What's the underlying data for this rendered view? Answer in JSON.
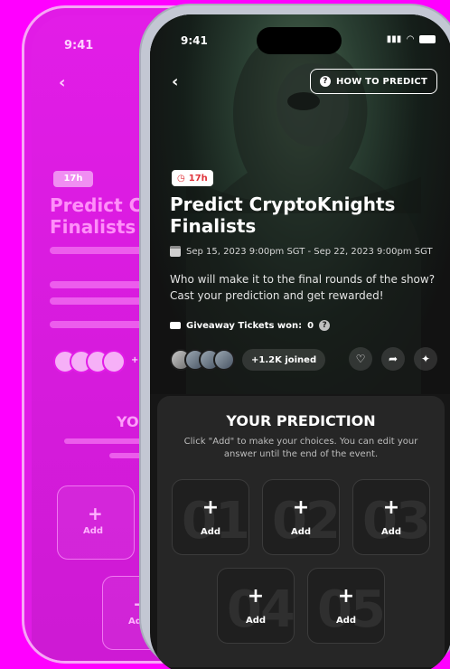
{
  "status": {
    "time": "9:41"
  },
  "header": {
    "how_to_predict": "HOW TO PREDICT"
  },
  "event": {
    "timer": "17h",
    "title": "Predict CryptoKnights Finalists",
    "date_range": "Sep 15, 2023 9:00pm SGT - Sep 22, 2023 9:00pm SGT",
    "description": "Who will make it to the final rounds of the show? Cast your prediction and get rewarded!",
    "tickets_label": "Giveaway Tickets won:",
    "tickets_value": "0",
    "joined": "+1.2K joined"
  },
  "prediction": {
    "title": "YOUR PREDICTION",
    "subtitle": "Click \"Add\" to make your choices. You can edit your answer until the end of the event.",
    "slots": [
      {
        "number": "01",
        "label": "Add"
      },
      {
        "number": "02",
        "label": "Add"
      },
      {
        "number": "03",
        "label": "Add"
      },
      {
        "number": "04",
        "label": "Add"
      },
      {
        "number": "05",
        "label": "Add"
      }
    ]
  },
  "back_phone": {
    "time": "9:41",
    "timer": "17h",
    "title_l1": "Predict Cr",
    "title_l2": "Finalists",
    "your": "YOU",
    "add": "Add",
    "joined": "+1.2K"
  },
  "colors": {
    "background": "#ff00ff",
    "accent": "#e0343b",
    "card": "#262626"
  },
  "icons": [
    "back-arrow-icon",
    "question-icon",
    "clock-icon",
    "calendar-icon",
    "ticket-icon",
    "info-icon",
    "heart-icon",
    "share-icon",
    "chat-icon",
    "plus-icon"
  ]
}
